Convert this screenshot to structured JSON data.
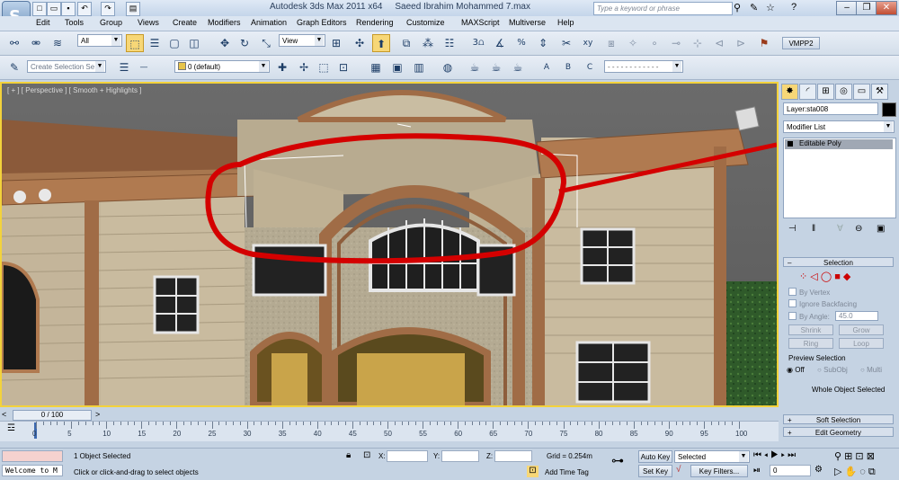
{
  "window": {
    "app_title": "Autodesk 3ds Max  2011 x64",
    "file_title": "Saeed Ibrahim Mohammed 7.max",
    "search_placeholder": "Type a keyword or phrase"
  },
  "menu": [
    "Edit",
    "Tools",
    "Group",
    "Views",
    "Create",
    "Modifiers",
    "Animation",
    "Graph Editors",
    "Rendering",
    "Customize",
    "MAXScript",
    "Multiverse",
    "Help"
  ],
  "toolbar1": {
    "filter": "All",
    "ref_coord": "View",
    "snap_label": "3",
    "vmpp_label": "VMPP2"
  },
  "toolbar2": {
    "selection_set_placeholder": "Create Selection Se",
    "layer": "0 (default)"
  },
  "viewport": {
    "label": "[ + ] [ Perspective ] [ Smooth + Highlights ]"
  },
  "command_panel": {
    "object_name": "Layer:sta008",
    "modifier_list": "Modifier List",
    "stack_item": "Editable Poly",
    "selection_rollout": "Selection",
    "by_vertex": "By Vertex",
    "ignore_backfacing": "Ignore Backfacing",
    "by_angle": "By Angle:",
    "angle_value": "45.0",
    "shrink": "Shrink",
    "grow": "Grow",
    "ring": "Ring",
    "loop": "Loop",
    "preview_selection": "Preview Selection",
    "off": "Off",
    "subobj": "SubObj",
    "multi": "Multi",
    "whole_object": "Whole Object Selected",
    "soft_selection": "Soft Selection",
    "edit_geometry": "Edit Geometry"
  },
  "timeline": {
    "frame": "0 / 100",
    "ticks": [
      "0",
      "5",
      "10",
      "15",
      "20",
      "25",
      "30",
      "35",
      "40",
      "45",
      "50",
      "55",
      "60",
      "65",
      "70",
      "75",
      "80",
      "85",
      "90",
      "95",
      "100"
    ]
  },
  "status": {
    "maxscript": "Welcome to M",
    "selected": "1 Object Selected",
    "prompt": "Click or click-and-drag to select objects",
    "x_label": "X:",
    "y_label": "Y:",
    "z_label": "Z:",
    "grid": "Grid = 0.254m",
    "add_time_tag": "Add Time Tag",
    "auto_key": "Auto Key",
    "set_key": "Set Key",
    "key_mode": "Selected",
    "key_filters": "Key Filters...",
    "frame_value": "0"
  },
  "colors": {
    "annotation": "#d40000",
    "viewport_border": "#f3d23b"
  }
}
